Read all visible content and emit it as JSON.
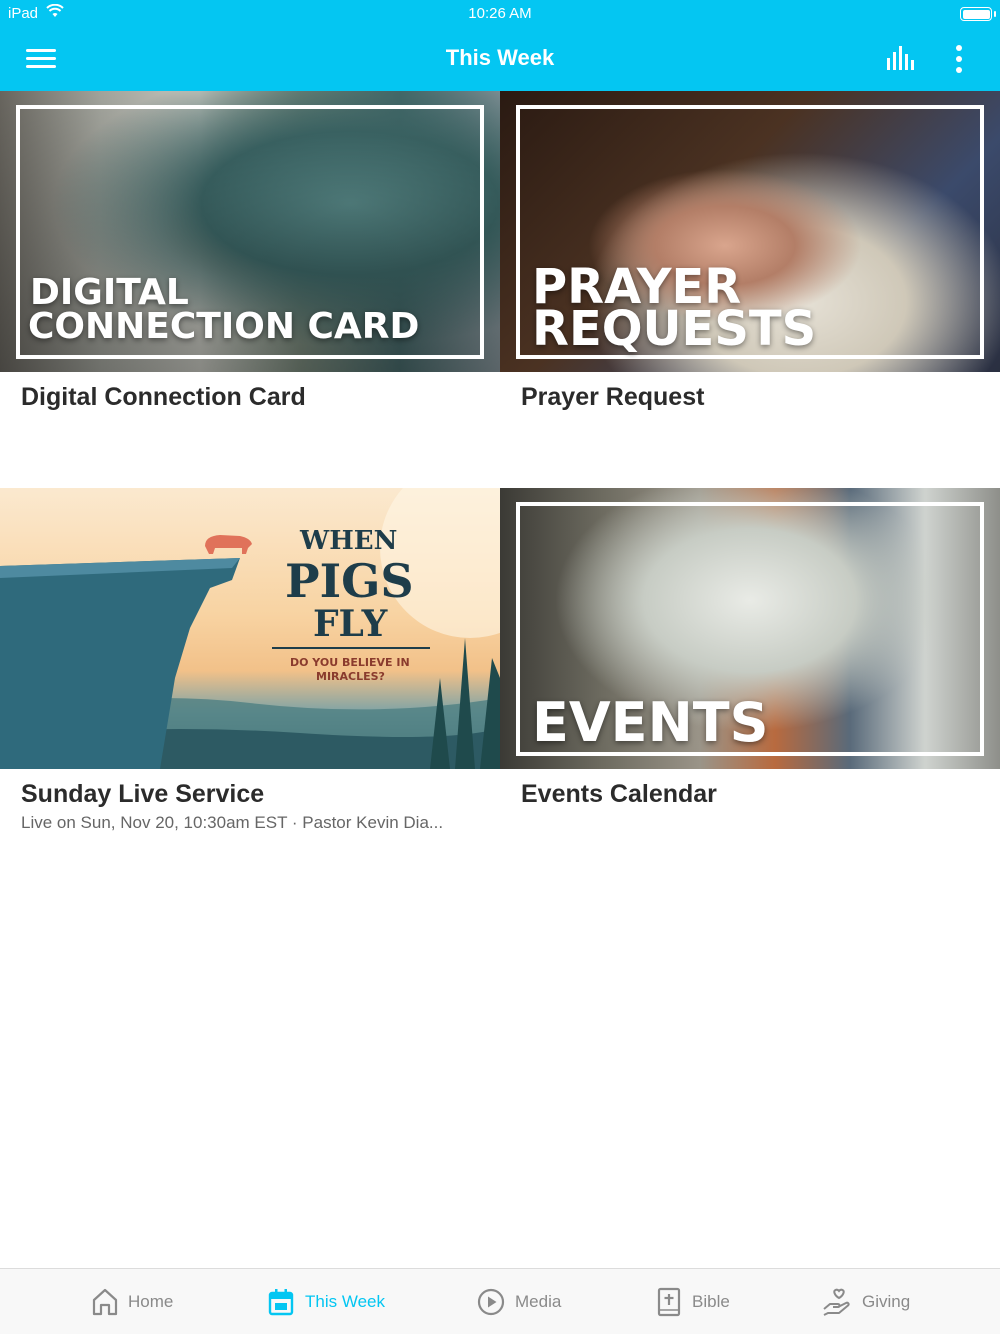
{
  "status": {
    "device": "iPad",
    "time": "10:26 AM"
  },
  "header": {
    "title": "This Week"
  },
  "cards": [
    {
      "thumb_text_line1": "DIGITAL",
      "thumb_text_line2": "CONNECTION CARD",
      "title": "Digital Connection Card",
      "subtitle": ""
    },
    {
      "thumb_text_line1": "PRAYER",
      "thumb_text_line2": "REQUESTS",
      "title": "Prayer Request",
      "subtitle": ""
    },
    {
      "thumb_text_line1": "WHEN",
      "thumb_text_line2": "PIGS",
      "thumb_text_line3": "FLY",
      "thumb_text_line4": "DO YOU BELIEVE IN",
      "thumb_text_line5": "MIRACLES?",
      "title": "Sunday Live Service",
      "subtitle": "Live on Sun, Nov 20, 10:30am EST · Pastor Kevin Dia..."
    },
    {
      "thumb_text_line1": "EVENTS",
      "title": "Events Calendar",
      "subtitle": ""
    }
  ],
  "tabs": [
    {
      "label": "Home",
      "icon": "home-icon",
      "active": false
    },
    {
      "label": "This Week",
      "icon": "calendar-icon",
      "active": true
    },
    {
      "label": "Media",
      "icon": "play-circle-icon",
      "active": false
    },
    {
      "label": "Bible",
      "icon": "bible-icon",
      "active": false
    },
    {
      "label": "Giving",
      "icon": "giving-hand-icon",
      "active": false
    }
  ],
  "colors": {
    "accent": "#04c6f2",
    "tab_inactive": "#8a8a8a",
    "title_text": "#2b2b2b"
  }
}
